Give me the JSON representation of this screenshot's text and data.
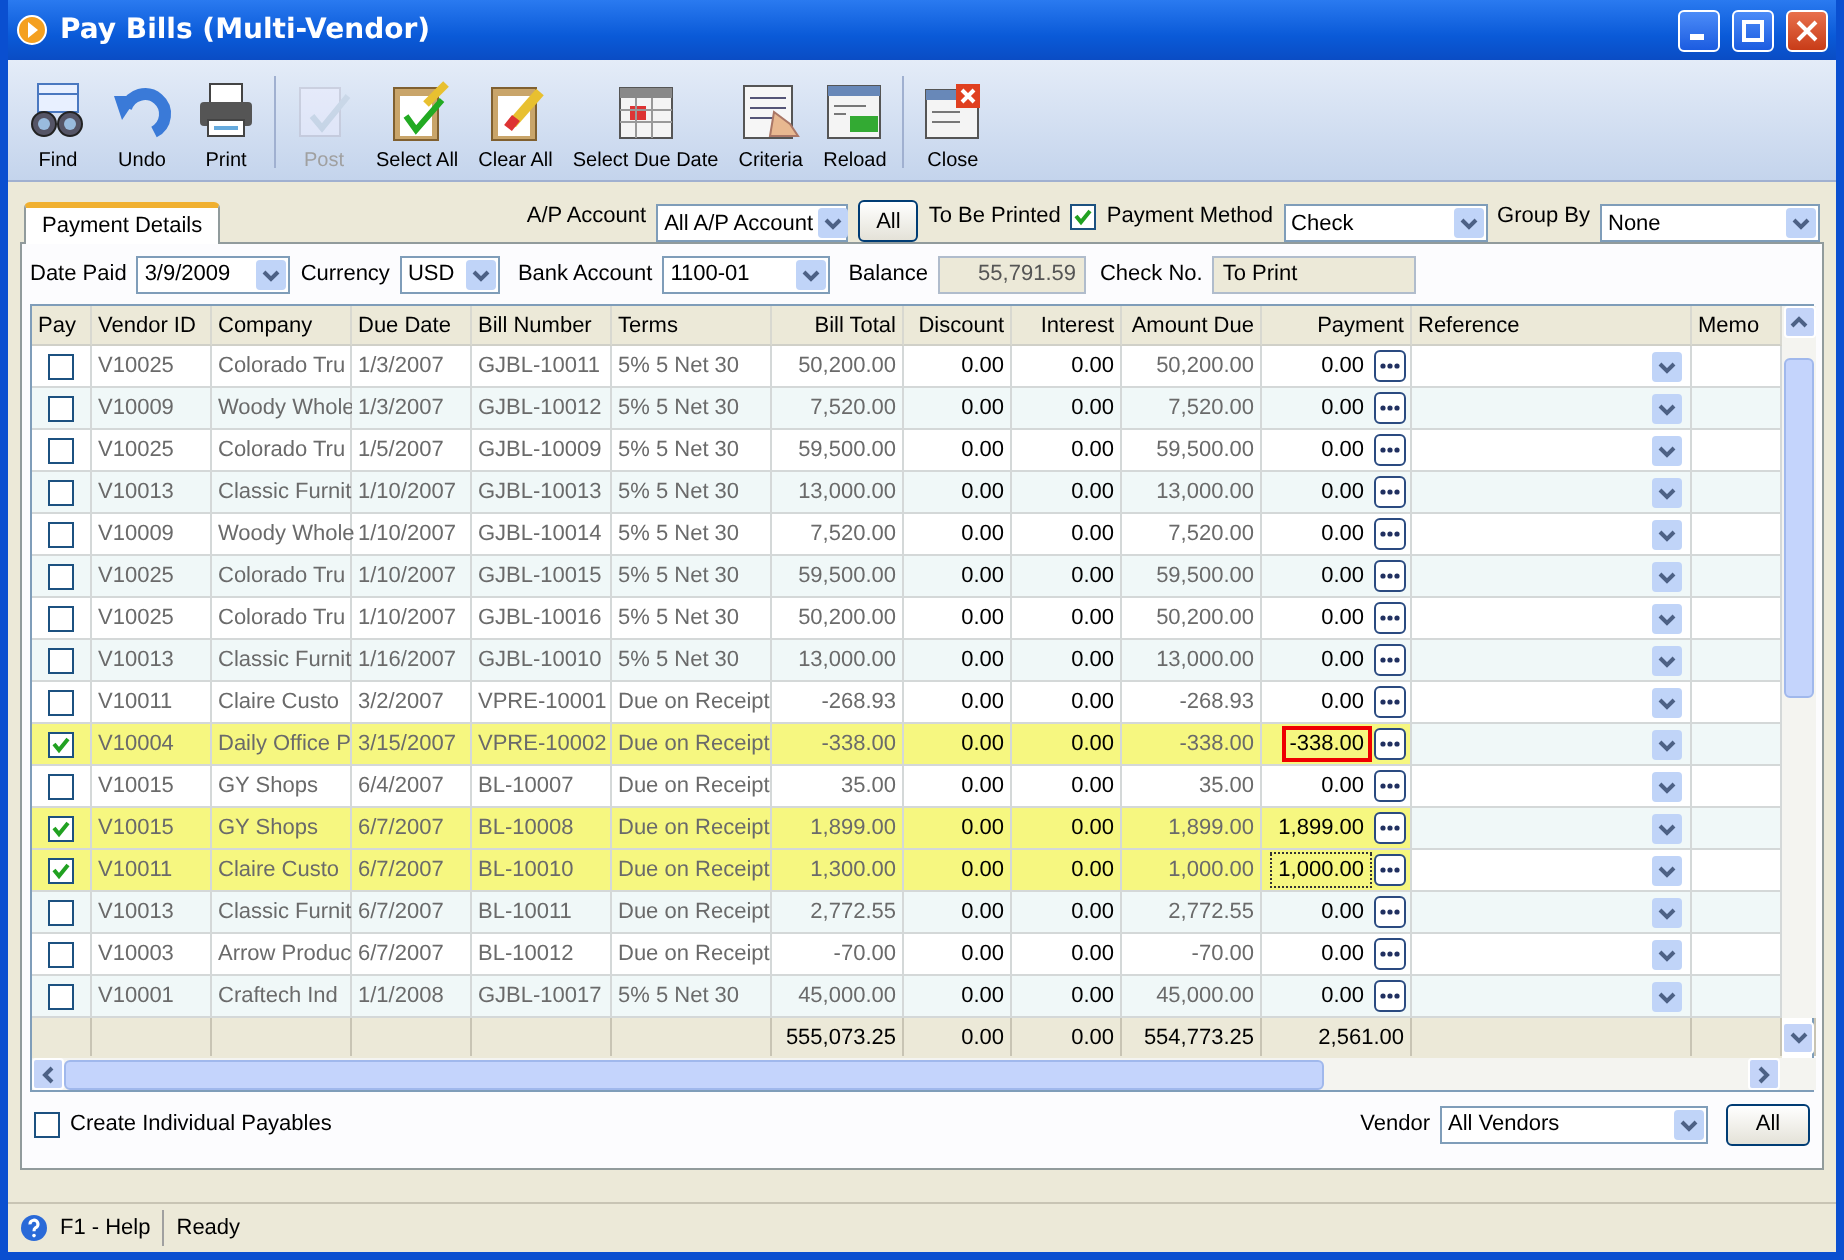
{
  "window": {
    "title": "Pay Bills (Multi-Vendor)"
  },
  "toolbar": [
    {
      "label": "Find",
      "disabled": false
    },
    {
      "label": "Undo",
      "disabled": false
    },
    {
      "label": "Print",
      "disabled": false
    },
    {
      "label": "Post",
      "disabled": true
    },
    {
      "label": "Select All",
      "disabled": false
    },
    {
      "label": "Clear All",
      "disabled": false
    },
    {
      "label": "Select Due Date",
      "disabled": false
    },
    {
      "label": "Criteria",
      "disabled": false
    },
    {
      "label": "Reload",
      "disabled": false
    },
    {
      "label": "Close",
      "disabled": false
    }
  ],
  "tabs": [
    {
      "label": "Payment Details",
      "selected": true
    }
  ],
  "filters": {
    "ap_account": {
      "label": "A/P Account",
      "value": "All A/P Account"
    },
    "all_button": "All",
    "to_be_printed": {
      "label": "To Be Printed",
      "checked": true
    },
    "payment_method": {
      "label": "Payment Method",
      "value": "Check"
    },
    "group_by": {
      "label": "Group By",
      "value": "None"
    },
    "date_paid": {
      "label": "Date Paid",
      "value": "3/9/2009"
    },
    "currency": {
      "label": "Currency",
      "value": "USD"
    },
    "bank_account": {
      "label": "Bank Account",
      "value": "1100-01"
    },
    "balance": {
      "label": "Balance",
      "value": "55,791.59"
    },
    "check_no": {
      "label": "Check No.",
      "value": "To Print"
    }
  },
  "table": {
    "columns": [
      "Pay",
      "Vendor ID",
      "Company",
      "Due Date",
      "Bill Number",
      "Terms",
      "Bill Total",
      "Discount",
      "Interest",
      "Amount Due",
      "Payment",
      "Reference",
      "Memo"
    ],
    "rows": [
      {
        "pay": false,
        "vendor_id": "V10025",
        "company": "Colorado Tru",
        "due_date": "1/3/2007",
        "bill_number": "GJBL-10011",
        "terms": "5% 5 Net 30",
        "bill_total": "50,200.00",
        "discount": "0.00",
        "interest": "0.00",
        "amount_due": "50,200.00",
        "payment": "0.00",
        "invalid": false,
        "focused": false
      },
      {
        "pay": false,
        "vendor_id": "V10009",
        "company": "Woody Whole",
        "due_date": "1/3/2007",
        "bill_number": "GJBL-10012",
        "terms": "5% 5 Net 30",
        "bill_total": "7,520.00",
        "discount": "0.00",
        "interest": "0.00",
        "amount_due": "7,520.00",
        "payment": "0.00",
        "invalid": false,
        "focused": false
      },
      {
        "pay": false,
        "vendor_id": "V10025",
        "company": "Colorado Tru",
        "due_date": "1/5/2007",
        "bill_number": "GJBL-10009",
        "terms": "5% 5 Net 30",
        "bill_total": "59,500.00",
        "discount": "0.00",
        "interest": "0.00",
        "amount_due": "59,500.00",
        "payment": "0.00",
        "invalid": false,
        "focused": false
      },
      {
        "pay": false,
        "vendor_id": "V10013",
        "company": "Classic Furnit",
        "due_date": "1/10/2007",
        "bill_number": "GJBL-10013",
        "terms": "5% 5 Net 30",
        "bill_total": "13,000.00",
        "discount": "0.00",
        "interest": "0.00",
        "amount_due": "13,000.00",
        "payment": "0.00",
        "invalid": false,
        "focused": false
      },
      {
        "pay": false,
        "vendor_id": "V10009",
        "company": "Woody Whole",
        "due_date": "1/10/2007",
        "bill_number": "GJBL-10014",
        "terms": "5% 5 Net 30",
        "bill_total": "7,520.00",
        "discount": "0.00",
        "interest": "0.00",
        "amount_due": "7,520.00",
        "payment": "0.00",
        "invalid": false,
        "focused": false
      },
      {
        "pay": false,
        "vendor_id": "V10025",
        "company": "Colorado Tru",
        "due_date": "1/10/2007",
        "bill_number": "GJBL-10015",
        "terms": "5% 5 Net 30",
        "bill_total": "59,500.00",
        "discount": "0.00",
        "interest": "0.00",
        "amount_due": "59,500.00",
        "payment": "0.00",
        "invalid": false,
        "focused": false
      },
      {
        "pay": false,
        "vendor_id": "V10025",
        "company": "Colorado Tru",
        "due_date": "1/10/2007",
        "bill_number": "GJBL-10016",
        "terms": "5% 5 Net 30",
        "bill_total": "50,200.00",
        "discount": "0.00",
        "interest": "0.00",
        "amount_due": "50,200.00",
        "payment": "0.00",
        "invalid": false,
        "focused": false
      },
      {
        "pay": false,
        "vendor_id": "V10013",
        "company": "Classic Furnit",
        "due_date": "1/16/2007",
        "bill_number": "GJBL-10010",
        "terms": "5% 5 Net 30",
        "bill_total": "13,000.00",
        "discount": "0.00",
        "interest": "0.00",
        "amount_due": "13,000.00",
        "payment": "0.00",
        "invalid": false,
        "focused": false
      },
      {
        "pay": false,
        "vendor_id": "V10011",
        "company": "Claire Custo",
        "due_date": "3/2/2007",
        "bill_number": "VPRE-10001",
        "terms": "Due on Receipt",
        "bill_total": "-268.93",
        "discount": "0.00",
        "interest": "0.00",
        "amount_due": "-268.93",
        "payment": "0.00",
        "invalid": false,
        "focused": false
      },
      {
        "pay": true,
        "vendor_id": "V10004",
        "company": "Daily Office P",
        "due_date": "3/15/2007",
        "bill_number": "VPRE-10002",
        "terms": "Due on Receipt",
        "bill_total": "-338.00",
        "discount": "0.00",
        "interest": "0.00",
        "amount_due": "-338.00",
        "payment": "-338.00",
        "invalid": true,
        "focused": false
      },
      {
        "pay": false,
        "vendor_id": "V10015",
        "company": "GY Shops",
        "due_date": "6/4/2007",
        "bill_number": "BL-10007",
        "terms": "Due on Receipt",
        "bill_total": "35.00",
        "discount": "0.00",
        "interest": "0.00",
        "amount_due": "35.00",
        "payment": "0.00",
        "invalid": false,
        "focused": false
      },
      {
        "pay": true,
        "vendor_id": "V10015",
        "company": "GY Shops",
        "due_date": "6/7/2007",
        "bill_number": "BL-10008",
        "terms": "Due on Receipt",
        "bill_total": "1,899.00",
        "discount": "0.00",
        "interest": "0.00",
        "amount_due": "1,899.00",
        "payment": "1,899.00",
        "invalid": false,
        "focused": false
      },
      {
        "pay": true,
        "vendor_id": "V10011",
        "company": "Claire Custo",
        "due_date": "6/7/2007",
        "bill_number": "BL-10010",
        "terms": "Due on Receipt",
        "bill_total": "1,300.00",
        "discount": "0.00",
        "interest": "0.00",
        "amount_due": "1,000.00",
        "payment": "1,000.00",
        "invalid": false,
        "focused": true
      },
      {
        "pay": false,
        "vendor_id": "V10013",
        "company": "Classic Furnit",
        "due_date": "6/7/2007",
        "bill_number": "BL-10011",
        "terms": "Due on Receipt",
        "bill_total": "2,772.55",
        "discount": "0.00",
        "interest": "0.00",
        "amount_due": "2,772.55",
        "payment": "0.00",
        "invalid": false,
        "focused": false
      },
      {
        "pay": false,
        "vendor_id": "V10003",
        "company": "Arrow Produc",
        "due_date": "6/7/2007",
        "bill_number": "BL-10012",
        "terms": "Due on Receipt",
        "bill_total": "-70.00",
        "discount": "0.00",
        "interest": "0.00",
        "amount_due": "-70.00",
        "payment": "0.00",
        "invalid": false,
        "focused": false
      },
      {
        "pay": false,
        "vendor_id": "V10001",
        "company": "Craftech Ind",
        "due_date": "1/1/2008",
        "bill_number": "GJBL-10017",
        "terms": "5% 5 Net 30",
        "bill_total": "45,000.00",
        "discount": "0.00",
        "interest": "0.00",
        "amount_due": "45,000.00",
        "payment": "0.00",
        "invalid": false,
        "focused": false
      }
    ],
    "totals": {
      "bill_total": "555,073.25",
      "discount": "0.00",
      "interest": "0.00",
      "amount_due": "554,773.25",
      "payment": "2,561.00"
    }
  },
  "bottom": {
    "create_individual_payables": {
      "label": "Create Individual Payables",
      "checked": false
    },
    "vendor": {
      "label": "Vendor",
      "value": "All Vendors"
    },
    "all_button": "All"
  },
  "status_bar": {
    "help": "F1 - Help",
    "status": "Ready"
  }
}
